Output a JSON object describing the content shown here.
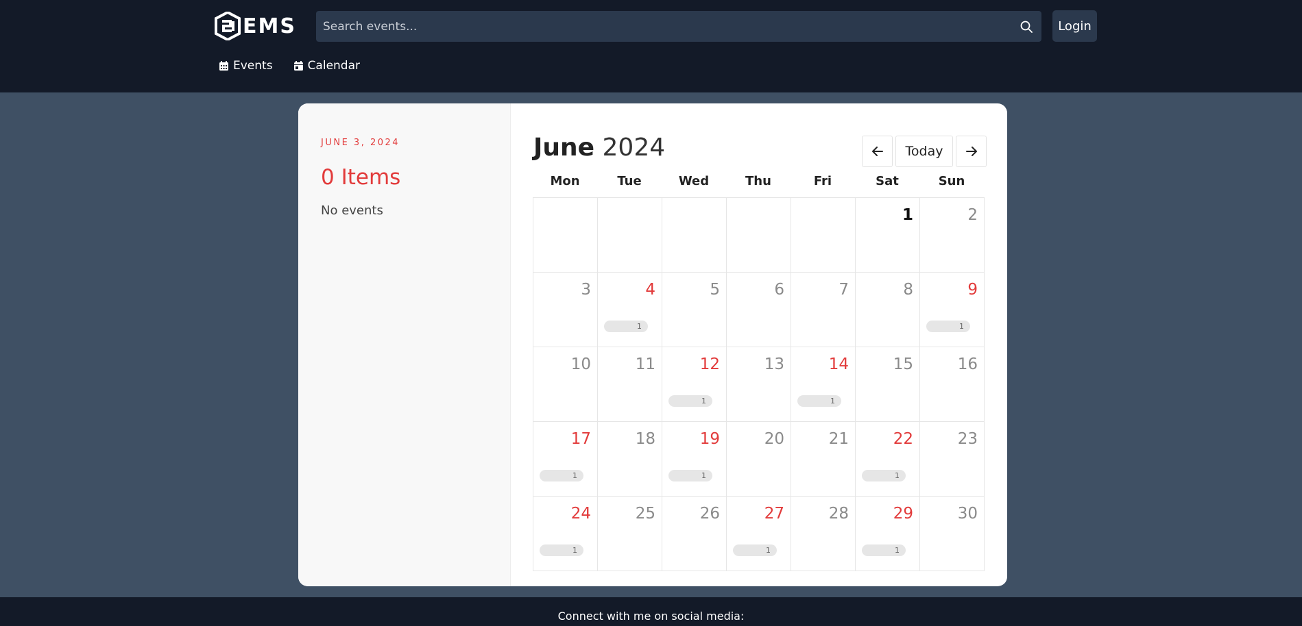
{
  "header": {
    "logo_text": "EMS",
    "search": {
      "placeholder": "Search events..."
    },
    "login_label": "Login"
  },
  "nav": {
    "items": [
      {
        "label": "Events",
        "icon": "calendar-grid-icon"
      },
      {
        "label": "Calendar",
        "icon": "calendar-day-icon"
      }
    ]
  },
  "sidebar": {
    "date": "JUNE 3, 2024",
    "count": "0 Items",
    "empty_text": "No events"
  },
  "calendar": {
    "month": "June",
    "year": "2024",
    "prev_icon": "arrow-left-icon",
    "next_icon": "arrow-right-icon",
    "today_label": "Today",
    "weekdays": [
      "Mon",
      "Tue",
      "Wed",
      "Thu",
      "Fri",
      "Sat",
      "Sun"
    ],
    "colors": {
      "accent": "#e23b3b",
      "muted": "#8a8a8a",
      "header_bg": "#131a28",
      "page_bg": "#3f5064"
    },
    "cells": [
      {
        "day": "",
        "state": "empty",
        "events": ""
      },
      {
        "day": "",
        "state": "empty",
        "events": ""
      },
      {
        "day": "",
        "state": "empty",
        "events": ""
      },
      {
        "day": "",
        "state": "empty",
        "events": ""
      },
      {
        "day": "",
        "state": "empty",
        "events": ""
      },
      {
        "day": "1",
        "state": "bold",
        "events": ""
      },
      {
        "day": "2",
        "state": "muted",
        "events": ""
      },
      {
        "day": "3",
        "state": "muted",
        "events": ""
      },
      {
        "day": "4",
        "state": "red",
        "events": "1"
      },
      {
        "day": "5",
        "state": "muted",
        "events": ""
      },
      {
        "day": "6",
        "state": "muted",
        "events": ""
      },
      {
        "day": "7",
        "state": "muted",
        "events": ""
      },
      {
        "day": "8",
        "state": "muted",
        "events": ""
      },
      {
        "day": "9",
        "state": "red",
        "events": "1"
      },
      {
        "day": "10",
        "state": "muted",
        "events": ""
      },
      {
        "day": "11",
        "state": "muted",
        "events": ""
      },
      {
        "day": "12",
        "state": "red",
        "events": "1"
      },
      {
        "day": "13",
        "state": "muted",
        "events": ""
      },
      {
        "day": "14",
        "state": "red",
        "events": "1"
      },
      {
        "day": "15",
        "state": "muted",
        "events": ""
      },
      {
        "day": "16",
        "state": "muted",
        "events": ""
      },
      {
        "day": "17",
        "state": "red",
        "events": "1"
      },
      {
        "day": "18",
        "state": "muted",
        "events": ""
      },
      {
        "day": "19",
        "state": "red",
        "events": "1"
      },
      {
        "day": "20",
        "state": "muted",
        "events": ""
      },
      {
        "day": "21",
        "state": "muted",
        "events": ""
      },
      {
        "day": "22",
        "state": "red",
        "events": "1"
      },
      {
        "day": "23",
        "state": "muted",
        "events": ""
      },
      {
        "day": "24",
        "state": "red",
        "events": "1"
      },
      {
        "day": "25",
        "state": "muted",
        "events": ""
      },
      {
        "day": "26",
        "state": "muted",
        "events": ""
      },
      {
        "day": "27",
        "state": "red",
        "events": "1"
      },
      {
        "day": "28",
        "state": "muted",
        "events": ""
      },
      {
        "day": "29",
        "state": "red",
        "events": "1"
      },
      {
        "day": "30",
        "state": "muted",
        "events": ""
      }
    ]
  },
  "footer": {
    "text": "Connect with me on social media:"
  }
}
